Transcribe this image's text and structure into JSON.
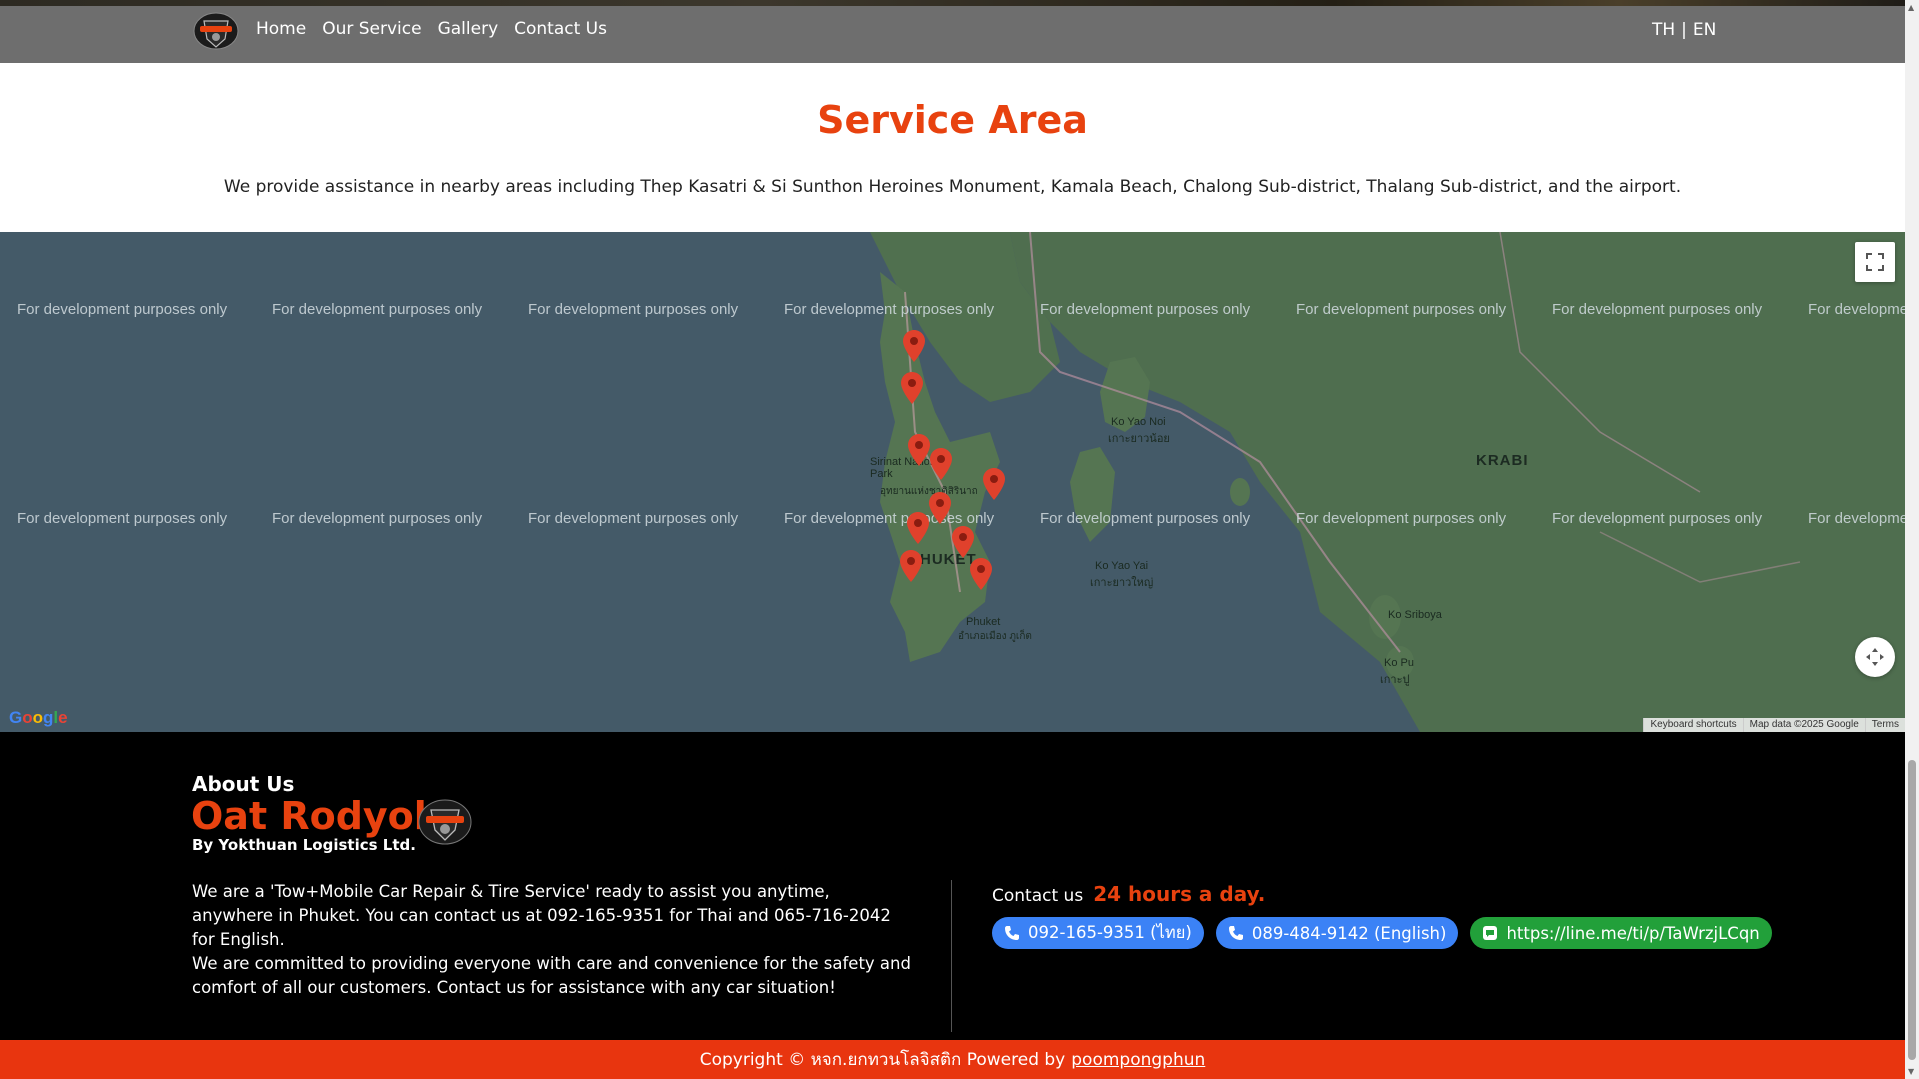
{
  "nav": {
    "links": [
      "Home",
      "Our Service",
      "Gallery",
      "Contact Us"
    ],
    "lang": {
      "th": "TH",
      "sep": "|",
      "en": "EN"
    }
  },
  "service": {
    "title": "Service Area",
    "description": "We provide assistance in nearby areas including Thep Kasatri & Si Sunthon Heroines Monument, Kamala Beach, Chalong Sub-district, Thalang Sub-district, and the airport."
  },
  "map": {
    "watermark": "For development purposes only",
    "labels": {
      "krabi": "KRABI",
      "phuket": "HUKET",
      "phuket_town": "Phuket",
      "phuket_town_th": "อำเภอเมือง ภูเก็ต",
      "ko_yao_noi": "Ko Yao Noi",
      "ko_yao_noi_th": "เกาะยาวน้อย",
      "ko_yao_yai": "Ko Yao Yai",
      "ko_yao_yai_th": "เกาะยาวใหญ่",
      "ko_sriboya": "Ko Sriboya",
      "ko_pu": "Ko Pu",
      "ko_pu_th": "เกาะปู",
      "sirinat": "Sirinat National Park",
      "sirinat_th": "อุทยานแห่งชาติสิรินาถ"
    },
    "google": "Google",
    "attribution": [
      "Keyboard shortcuts",
      "Map data ©2025 Google",
      "Terms"
    ],
    "pin_color": "#e0412c"
  },
  "footer": {
    "about_heading": "About Us",
    "brand": "Oat Rodyok",
    "by": "By Yokthuan Logistics Ltd.",
    "para1": "We are a 'Tow+Mobile Car Repair & Tire Service' ready to assist you anytime, anywhere in Phuket. You can contact us at 092-165-9351 for Thai and 065-716-2042 for English.",
    "para2": "We are committed to providing everyone with care and convenience for the safety and comfort of all our customers. Contact us for assistance with any car situation!",
    "contact_label": "Contact us",
    "contact_hours": "24 hours a day.",
    "phone_th": "092-165-9351 (ไทย)",
    "phone_en": "089-484-9142 (English)",
    "line": "https://line.me/ti/p/TaWrzjLCqn",
    "copyright": "Copyright © หจก.ยกทวนโลจิสติก Powered by",
    "powered_by": "poompongphun"
  },
  "colors": {
    "accent": "#e8420f",
    "nav_bg": "#6e6e6e",
    "footer_bg": "#000000",
    "phone_pill": "#3b82f6",
    "line_pill": "#22a03a"
  }
}
